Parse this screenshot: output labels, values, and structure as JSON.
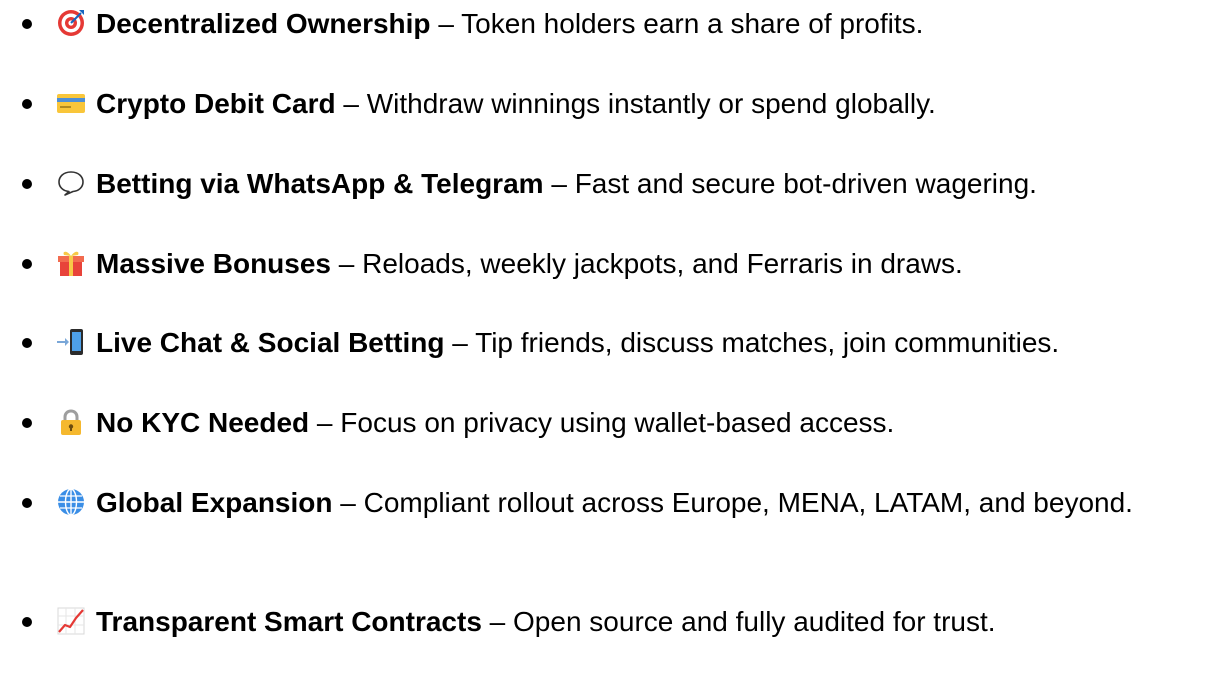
{
  "features": [
    {
      "icon": "target-icon",
      "title": "Decentralized Ownership",
      "separator": " – ",
      "description": "Token holders earn a share of profits."
    },
    {
      "icon": "credit-card-icon",
      "title": "Crypto Debit Card",
      "separator": " – ",
      "description": "Withdraw winnings instantly or spend globally."
    },
    {
      "icon": "speech-bubble-icon",
      "title": "Betting via WhatsApp & Telegram",
      "separator": " – ",
      "description": "Fast and secure bot-driven wagering."
    },
    {
      "icon": "gift-icon",
      "title": "Massive Bonuses",
      "separator": " – ",
      "description": "Reloads, weekly jackpots, and Ferraris in draws."
    },
    {
      "icon": "mobile-arrow-icon",
      "title": "Live Chat & Social Betting",
      "separator": " – ",
      "description": "Tip friends, discuss matches, join communities."
    },
    {
      "icon": "lock-icon",
      "title": "No KYC Needed",
      "separator": " – ",
      "description": "Focus on privacy using wallet-based access."
    },
    {
      "icon": "globe-icon",
      "title": "Global Expansion",
      "separator": " – ",
      "description": "Compliant rollout across Europe, MENA, LATAM, and beyond."
    },
    {
      "icon": "chart-increasing-icon",
      "title": "Transparent Smart Contracts",
      "separator": " – ",
      "description": "Open source and fully audited for trust."
    }
  ]
}
